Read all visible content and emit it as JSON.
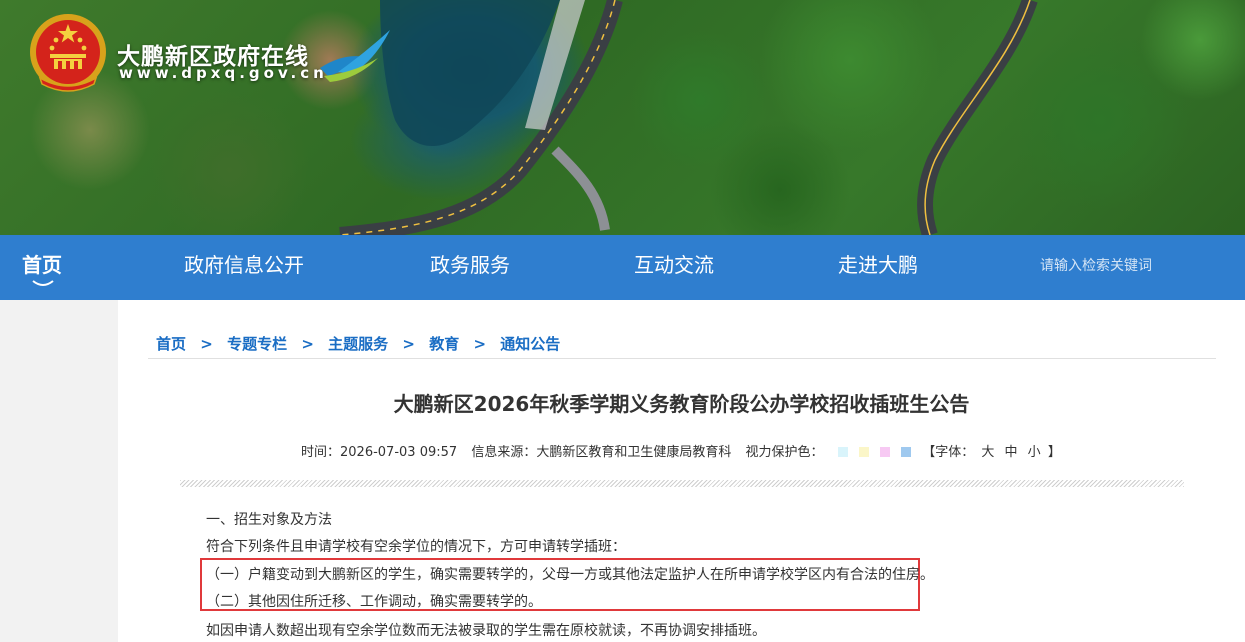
{
  "header": {
    "site_title": "大鹏新区政府在线",
    "site_url": "www.dpxq.gov.cn"
  },
  "nav": {
    "items": [
      {
        "label": "首页",
        "active": true
      },
      {
        "label": "政府信息公开",
        "active": false
      },
      {
        "label": "政务服务",
        "active": false
      },
      {
        "label": "互动交流",
        "active": false
      },
      {
        "label": "走进大鹏",
        "active": false
      }
    ],
    "search_placeholder": "请输入检索关键词"
  },
  "breadcrumb": {
    "items": [
      "首页",
      "专题专栏",
      "主题服务",
      "教育",
      "通知公告"
    ],
    "separator": ">"
  },
  "article": {
    "title": "大鹏新区2026年秋季学期义务教育阶段公办学校招收插班生公告",
    "time_label": "时间：",
    "time": "2026-07-03 09:57",
    "source_label": "信息来源：",
    "source": "大鹏新区教育和卫生健康局教育科",
    "eye_care_label": "视力保护色：",
    "eye_care_colors": [
      "#d9f4fb",
      "#fbf6c8",
      "#f7c9f3",
      "#9fc9ef"
    ],
    "font_label": "【字体：",
    "font_sizes": [
      "大",
      "中",
      "小"
    ],
    "font_close": "】",
    "paragraphs": [
      "一、招生对象及方法",
      "符合下列条件且申请学校有空余学位的情况下，方可申请转学插班：",
      "（一）户籍变动到大鹏新区的学生，确实需要转学的，父母一方或其他法定监护人在所申请学校学区内有合法的住房。",
      "（二）其他因住所迁移、工作调动，确实需要转学的。",
      "如因申请人数超出现有空余学位数而无法被录取的学生需在原校就读，不再协调安排插班。"
    ]
  },
  "colors": {
    "nav_bg": "#2f7ecf",
    "link": "#1a6dc4",
    "highlight_border": "#e0393b"
  }
}
